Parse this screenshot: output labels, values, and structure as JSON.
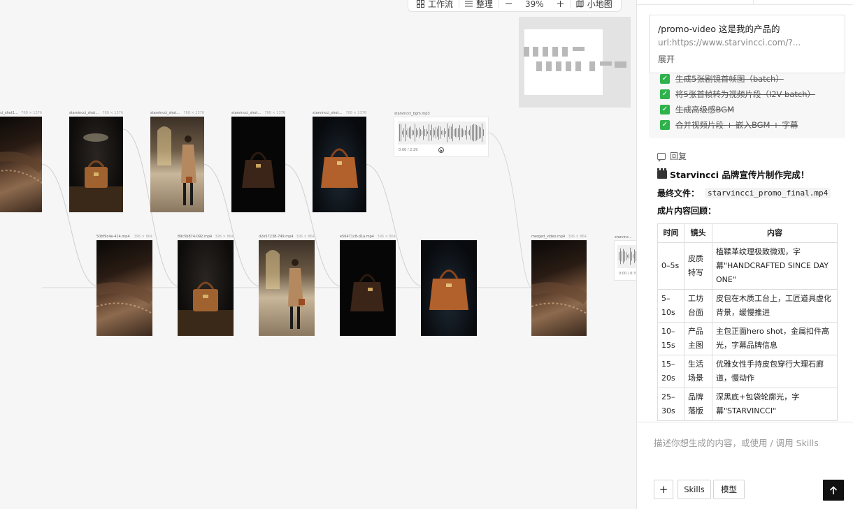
{
  "toolbar": {
    "workflow_label": "工作流",
    "arrange_label": "整理",
    "zoom_value": "39%",
    "minimap_label": "小地图"
  },
  "canvas": {
    "top_nodes": [
      {
        "name": "vincci_shot1...",
        "dims": "768 × 1376",
        "kind": "image",
        "bg": "bg-leather"
      },
      {
        "name": "starvincci_shot2...",
        "dims": "768 × 1376",
        "kind": "image",
        "bg": "bg-dark"
      },
      {
        "name": "starvincci_shot4...",
        "dims": "768 × 1376",
        "kind": "image",
        "bg": "bg-hall"
      },
      {
        "name": "starvincci_shot5...",
        "dims": "768 × 1376",
        "kind": "image",
        "bg": "bg-black"
      },
      {
        "name": "starvincci_shot3...",
        "dims": "768 × 1376",
        "kind": "image",
        "bg": "bg-navy"
      }
    ],
    "audio_node": {
      "name": "starvincci_bgm.mp3",
      "time": "0:00 / 2:29"
    },
    "bottom_nodes": [
      {
        "name": "50bf9c4e-414.mp4",
        "dims": "396 × 864",
        "bg": "bg-leather"
      },
      {
        "name": "89c5b874-092.mp4",
        "dims": "396 × 864",
        "bg": "bg-dark"
      },
      {
        "name": "d2e57238-749.mp4",
        "dims": "396 × 864",
        "bg": "bg-hall"
      },
      {
        "name": "e56471c8-d1a.mp4",
        "dims": "396 × 864",
        "bg": "bg-black"
      },
      {
        "name": "",
        "dims": "",
        "bg": "bg-navy"
      },
      {
        "name": "merged_video.mp4",
        "dims": "396 × 864",
        "bg": "bg-leather"
      }
    ],
    "partial_audio_node": {
      "name": "starvinc...",
      "time": "0:00 / 0:3"
    }
  },
  "user_message": {
    "line1": "/promo-video 这是我的产品的",
    "line2": "url:https://www.starvincci.com/?...",
    "expand_label": "展开"
  },
  "tasks": [
    "生成5张剧镜首帧图（batch）",
    "将5张首帧转为视频片段（I2V batch）",
    "生成高级感BGM",
    "合并视频片段 + 嵌入BGM + 字幕"
  ],
  "reply": {
    "header_label": "回复",
    "title": "Starvincci 品牌宣传片制作完成！",
    "final_file_label": "最终文件：",
    "final_file_name": "starvincci_promo_final.mp4",
    "recap_title": "成片内容回顾："
  },
  "scene_table": {
    "headers": [
      "时间",
      "镜头",
      "内容"
    ],
    "rows": [
      [
        "0–5s",
        "皮质特写",
        "植鞣革纹理极致微观，字幕\"HANDCRAFTED SINCE DAY ONE\""
      ],
      [
        "5–10s",
        "工坊台面",
        "皮包在木质工台上，工匠道具虚化背景，缓慢推进"
      ],
      [
        "10–15s",
        "产品主图",
        "主包正面hero shot，金属扣件高光，字幕品牌信息"
      ],
      [
        "15–20s",
        "生活场景",
        "优雅女性手持皮包穿行大理石廊道，慢动作"
      ],
      [
        "25–30s",
        "品牌落版",
        "深黑底+包袋轮廓光，字幕\"STARVINCCI\""
      ]
    ]
  },
  "input": {
    "placeholder": "描述你想生成的内容，或使用 / 调用 Skills",
    "plus_label": "+",
    "skills_label": "Skills",
    "model_label": "模型"
  },
  "colors": {
    "check_green": "#2fb24c",
    "send_button": "#111111",
    "minimap_bg": "#e3e3e3"
  }
}
